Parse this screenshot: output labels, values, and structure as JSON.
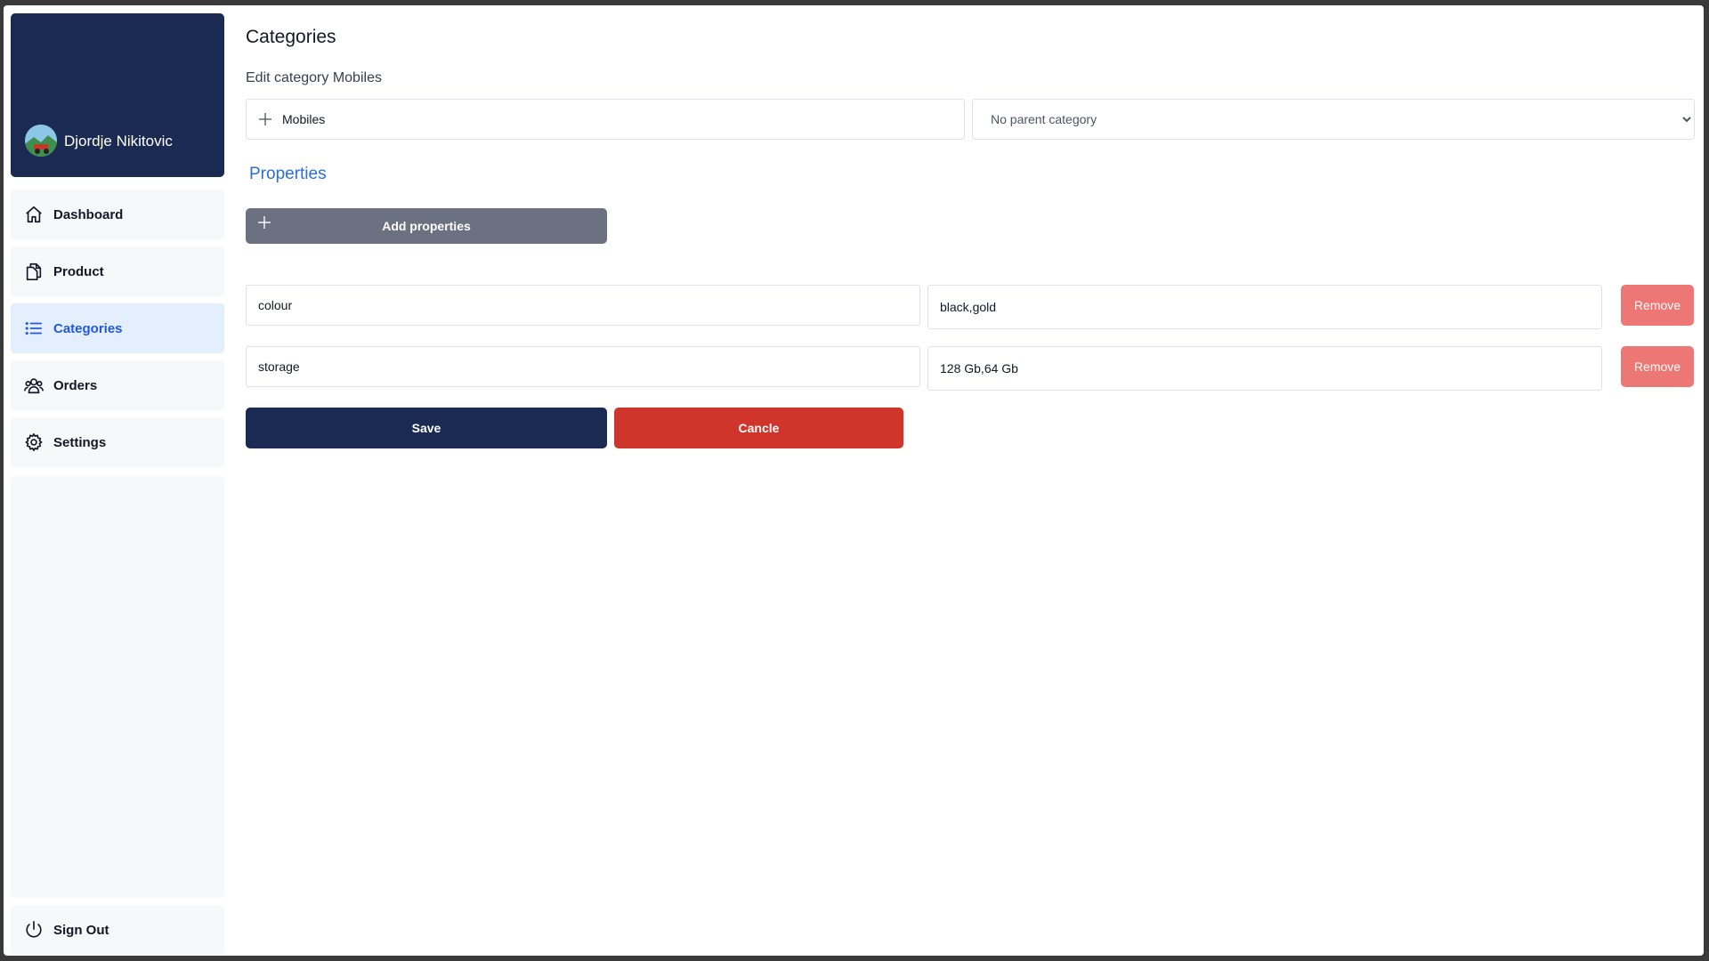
{
  "user": {
    "name": "Djordje Nikitovic"
  },
  "nav": {
    "items": [
      {
        "label": "Dashboard",
        "icon": "home-icon"
      },
      {
        "label": "Product",
        "icon": "documents-icon"
      },
      {
        "label": "Categories",
        "icon": "list-icon",
        "active": true
      },
      {
        "label": "Orders",
        "icon": "users-icon"
      },
      {
        "label": "Settings",
        "icon": "gear-icon"
      }
    ],
    "sign_out": "Sign Out"
  },
  "page": {
    "title": "Categories",
    "subtitle": "Edit category Mobiles"
  },
  "form": {
    "category_name": "Mobiles",
    "parent_select": "No parent category",
    "properties_title": "Properties",
    "add_properties_label": "Add properties",
    "properties": [
      {
        "name": "colour",
        "values": "black,gold",
        "remove_label": "Remove"
      },
      {
        "name": "storage",
        "values": "128 Gb,64 Gb",
        "remove_label": "Remove"
      }
    ],
    "save_label": "Save",
    "cancel_label": "Cancle"
  },
  "colors": {
    "sidebar_dark": "#1b2a52",
    "accent_blue": "#2a6fd8",
    "remove": "#ec7774",
    "cancel": "#d0352c",
    "add_button": "#6b7180"
  }
}
